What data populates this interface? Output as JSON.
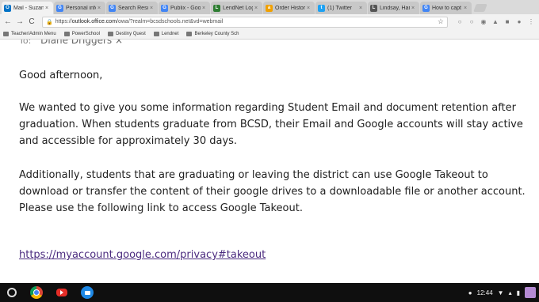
{
  "tabs": [
    {
      "label": "Mail - Suzann",
      "fav": "O",
      "color": "#0072c6",
      "active": true
    },
    {
      "label": "Personal info",
      "fav": "G",
      "color": "#4285f4",
      "active": false
    },
    {
      "label": "Search Resul",
      "fav": "G",
      "color": "#4285f4",
      "active": false
    },
    {
      "label": "Publix - Goog",
      "fav": "G",
      "color": "#4285f4",
      "active": false
    },
    {
      "label": "LendNet Logi",
      "fav": "L",
      "color": "#2e7d32",
      "active": false
    },
    {
      "label": "Order History",
      "fav": "a",
      "color": "#f0a000",
      "active": false
    },
    {
      "label": "(1) Twitter",
      "fav": "t",
      "color": "#1da1f2",
      "active": false
    },
    {
      "label": "Lindsay, Han",
      "fav": "L",
      "color": "#555555",
      "active": false
    },
    {
      "label": "How to capt",
      "fav": "G",
      "color": "#4285f4",
      "active": false
    }
  ],
  "toolbar": {
    "back": "←",
    "forward": "→",
    "reload": "C",
    "url_prefix": "https://",
    "url_host": "outlook.office.com",
    "url_path": "/owa/?realm=bcsdschools.net&vd=webmail",
    "star": "☆"
  },
  "bookmarks": [
    "Teacher/Admin Menu",
    "PowerSchool",
    "Destiny Quest",
    "Lendnet",
    "Berkeley County Sch"
  ],
  "email": {
    "to_label": "To:",
    "to_name": "Diane Driggers",
    "to_remove": "×",
    "greeting": "Good afternoon,",
    "paragraph1": "We wanted to give you some information regarding Student Email and document retention after graduation. When students graduate from BCSD, their Email and Google accounts will stay active and accessible for approximately 30 days.",
    "paragraph2": "Additionally, students that are graduating or leaving the district can use Google Takeout to download or transfer the content of their google drives to a downloadable file or another account. Please use the following link to access Google Takeout.",
    "link": "https://myaccount.google.com/privacy#takeout"
  },
  "shelf": {
    "time": "12:44"
  },
  "icons": [
    "back-icon",
    "forward-icon",
    "reload-icon",
    "lock-icon",
    "star-icon",
    "chrome-icon",
    "youtube-icon",
    "files-icon",
    "notification-icon",
    "wifi-icon",
    "battery-icon"
  ]
}
